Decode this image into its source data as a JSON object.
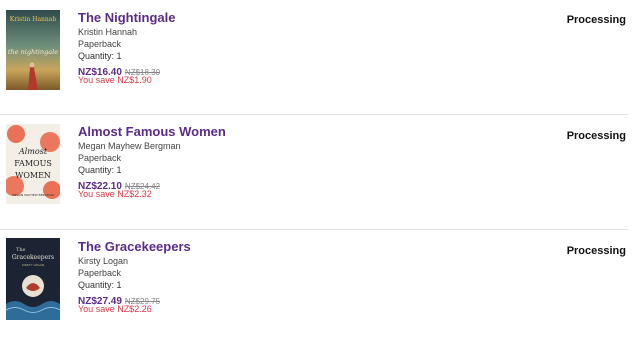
{
  "items": [
    {
      "title": "The Nightingale",
      "author": "Kristin Hannah",
      "format": "Paperback",
      "quantity": "Quantity: 1",
      "price": "NZ$16.40",
      "rrp": "NZ$18.30",
      "savings": "You save NZ$1.90",
      "status": "Processing",
      "cover_text": {
        "author": "Kristin Hannah",
        "title": "the nightingale"
      }
    },
    {
      "title": "Almost Famous Women",
      "author": "Megan Mayhew Bergman",
      "format": "Paperback",
      "quantity": "Quantity: 1",
      "price": "NZ$22.10",
      "rrp": "NZ$24.42",
      "savings": "You save NZ$2.32",
      "status": "Processing",
      "cover_text": {
        "title_line1": "Almost",
        "title_line2": "FAMOUS",
        "title_line3": "WOMEN",
        "author": "MEGAN MAYHEW BERGMAN"
      }
    },
    {
      "title": "The Gracekeepers",
      "author": "Kirsty Logan",
      "format": "Paperback",
      "quantity": "Quantity: 1",
      "price": "NZ$27.49",
      "rrp": "NZ$29.75",
      "savings": "You save NZ$2.26",
      "status": "Processing",
      "cover_text": {
        "title_line1": "The",
        "title_line2": "Gracekeepers",
        "author": "KIRSTY LOGAN"
      }
    }
  ],
  "colors": {
    "title": "#5b2d86",
    "price": "#5b2d86",
    "savings": "#d9374a"
  }
}
